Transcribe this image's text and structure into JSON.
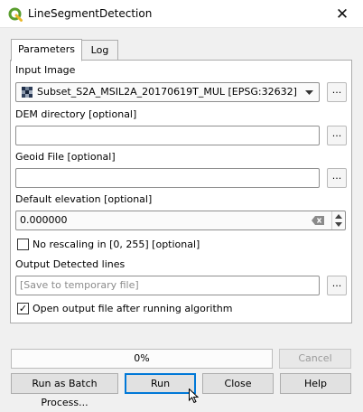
{
  "window": {
    "title": "LineSegmentDetection",
    "close_glyph": "✕"
  },
  "tabs": [
    {
      "label": "Parameters"
    },
    {
      "label": "Log"
    }
  ],
  "params": {
    "input_image": {
      "label": "Input Image",
      "value": "Subset_S2A_MSIL2A_20170619T_MUL [EPSG:32632]",
      "browse": "..."
    },
    "dem": {
      "label": "DEM directory [optional]",
      "value": "",
      "browse": "..."
    },
    "geoid": {
      "label": "Geoid File [optional]",
      "value": "",
      "browse": "..."
    },
    "elevation": {
      "label": "Default elevation [optional]",
      "value": "0.000000"
    },
    "no_rescaling": {
      "label": "No rescaling in [0, 255] [optional]",
      "checked": false
    },
    "output": {
      "label": "Output Detected lines",
      "placeholder": "[Save to temporary file]",
      "browse": "..."
    },
    "open_output": {
      "label": "Open output file after running algorithm",
      "checked": true,
      "check_glyph": "✓"
    }
  },
  "progress": {
    "value": 0,
    "label": "0%"
  },
  "buttons": {
    "cancel": "Cancel",
    "batch": "Run as Batch Process...",
    "run": "Run",
    "close": "Close",
    "help": "Help"
  },
  "colors": {
    "accent": "#0078d7",
    "qgis_green": "#5a9e2f"
  }
}
